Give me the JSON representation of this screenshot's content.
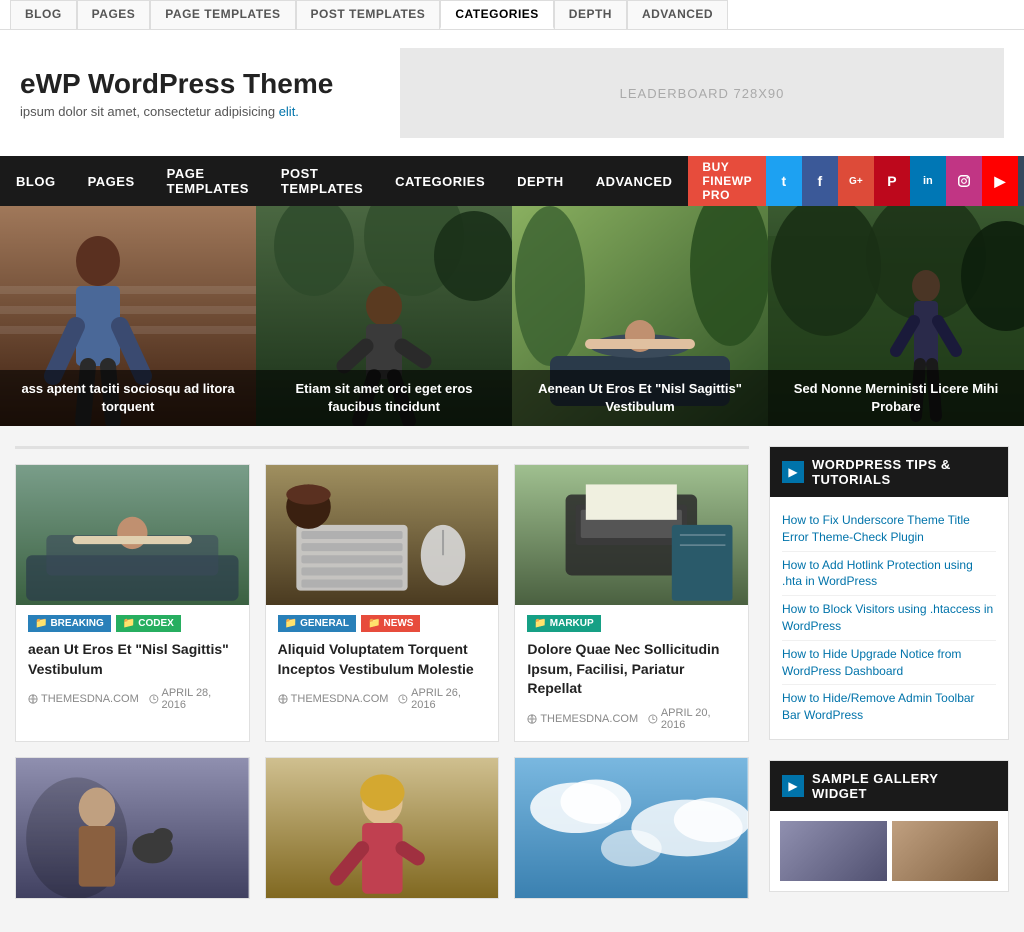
{
  "admin_bar": {
    "tabs": [
      {
        "label": "BLOG",
        "active": false
      },
      {
        "label": "PAGES",
        "active": false
      },
      {
        "label": "PAGE TEMPLATES",
        "active": false
      },
      {
        "label": "POST TEMPLATES",
        "active": false
      },
      {
        "label": "CATEGORIES",
        "active": true
      },
      {
        "label": "DEPTH",
        "active": false
      },
      {
        "label": "ADVANCED",
        "active": false
      }
    ]
  },
  "site": {
    "title": "eWP WordPress Theme",
    "tagline": "ipsum dolor sit amet, consectetur adipisicing elit.",
    "tagline_link": "elit.",
    "ad_label": "LEADERBOARD 728X90"
  },
  "nav": {
    "links": [
      {
        "label": "BLOG",
        "active": false
      },
      {
        "label": "PAGES",
        "active": false
      },
      {
        "label": "PAGE TEMPLATES",
        "active": false
      },
      {
        "label": "POST TEMPLATES",
        "active": false
      },
      {
        "label": "CATEGORIES",
        "active": false
      },
      {
        "label": "DEPTH",
        "active": false
      },
      {
        "label": "ADVANCED",
        "active": false
      }
    ],
    "buy_label": "BUY FINEWP PRO",
    "social": [
      {
        "name": "twitter",
        "label": "t"
      },
      {
        "name": "facebook",
        "label": "f"
      },
      {
        "name": "google",
        "label": "G+"
      },
      {
        "name": "pinterest",
        "label": "P"
      },
      {
        "name": "linkedin",
        "label": "in"
      },
      {
        "name": "instagram",
        "label": "◻"
      },
      {
        "name": "youtube",
        "label": "▶"
      },
      {
        "name": "mail",
        "label": "✉"
      },
      {
        "name": "rss",
        "label": "◉"
      }
    ]
  },
  "featured": [
    {
      "caption": "ass aptent taciti sociosqu ad litora torquent",
      "img_class": "feat-img-1"
    },
    {
      "caption": "Etiam sit amet orci eget eros faucibus tincidunt",
      "img_class": "feat-img-2"
    },
    {
      "caption": "Aenean Ut Eros Et \"Nisl Sagittis\" Vestibulum",
      "img_class": "feat-img-3"
    },
    {
      "caption": "Sed Nonne Merninisti Licere Mihi Probare",
      "img_class": "feat-img-4"
    }
  ],
  "cards": [
    {
      "tags": [
        {
          "label": "BREAKING",
          "class": "tag-breaking"
        },
        {
          "label": "CODEX",
          "class": "tag-codex"
        }
      ],
      "title": "aean Ut Eros Et \"Nisl Sagittis\" Vestibulum",
      "meta_site": "THEMESDNA.COM",
      "meta_date": "APRIL 28, 2016",
      "img_class": "card-img-1"
    },
    {
      "tags": [
        {
          "label": "GENERAL",
          "class": "tag-general"
        },
        {
          "label": "NEWS",
          "class": "tag-news"
        }
      ],
      "title": "Aliquid Voluptatem Torquent Inceptos Vestibulum Molestie",
      "meta_site": "THEMESDNA.COM",
      "meta_date": "APRIL 26, 2016",
      "img_class": "card-img-2"
    },
    {
      "tags": [
        {
          "label": "MARKUP",
          "class": "tag-markup"
        }
      ],
      "title": "Dolore Quae Nec Sollicitudin Ipsum, Facilisi, Pariatur Repellat",
      "meta_site": "THEMESDNA.COM",
      "meta_date": "APRIL 20, 2016",
      "img_class": "card-img-3"
    }
  ],
  "cards_bottom": [
    {
      "img_class": "card-img-4",
      "tags": [],
      "title": "",
      "meta_site": "",
      "meta_date": ""
    },
    {
      "img_class": "card-img-5",
      "tags": [],
      "title": "",
      "meta_site": "",
      "meta_date": ""
    },
    {
      "img_class": "card-img-6",
      "tags": [],
      "title": "",
      "meta_site": "",
      "meta_date": ""
    }
  ],
  "sidebar": {
    "widgets": [
      {
        "title": "WORDPRESS TIPS & TUTORIALS",
        "links": [
          "How to Fix Underscore Theme Title Error Theme-Check Plugin",
          "How to Add Hotlink Protection using .hta in WordPress",
          "How to Block Visitors using .htaccess in WordPress",
          "How to Hide Upgrade Notice from WordPress Dashboard",
          "How to Hide/Remove Admin Toolbar Bar WordPress"
        ]
      },
      {
        "title": "SAMPLE GALLERY WIDGET",
        "links": []
      }
    ]
  }
}
